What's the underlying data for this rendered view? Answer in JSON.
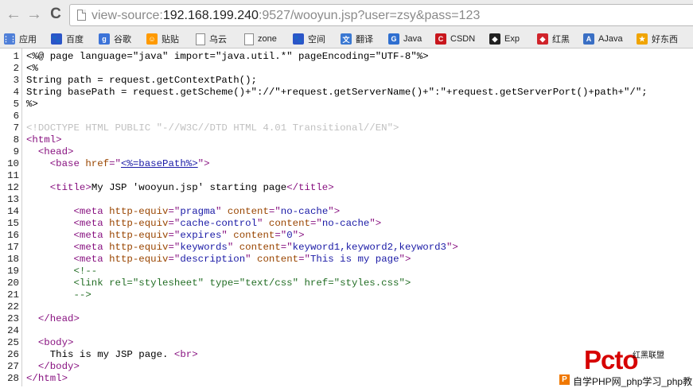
{
  "browser": {
    "back_icon": "arrow-left-icon",
    "forward_icon": "arrow-right-icon",
    "reload_icon": "reload-icon",
    "page_icon": "page-icon",
    "url_scheme": "view-source:",
    "url_host": "192.168.199.240",
    "url_rest": ":9527/wooyun.jsp?user=zsy&pass=123"
  },
  "bookmarks": [
    {
      "label": "应用",
      "icon": "apps-grid-icon",
      "color": "#4f7fd8",
      "glyph": "⋮⋮"
    },
    {
      "label": "百度",
      "icon": "baidu-icon",
      "color": "#2b55c8",
      "glyph": "🐾"
    },
    {
      "label": "谷歌",
      "icon": "google-icon",
      "color": "#3c73d8",
      "glyph": "g"
    },
    {
      "label": "贴贴",
      "icon": "tieba-icon",
      "color": "#ff9a00",
      "glyph": "☺"
    },
    {
      "label": "乌云",
      "icon": "folder-icon",
      "color": "#ffffff",
      "glyph": ""
    },
    {
      "label": "zone",
      "icon": "folder-icon",
      "color": "#ffffff",
      "glyph": ""
    },
    {
      "label": "空间",
      "icon": "baidu-space-icon",
      "color": "#2b55c8",
      "glyph": "🐾"
    },
    {
      "label": "翻译",
      "icon": "translate-icon",
      "color": "#3a78d2",
      "glyph": "文"
    },
    {
      "label": "Java",
      "icon": "java-icon",
      "color": "#2f6fd0",
      "glyph": "G"
    },
    {
      "label": "CSDN",
      "icon": "csdn-icon",
      "color": "#c8161d",
      "glyph": "C"
    },
    {
      "label": "Exp",
      "icon": "exploit-icon",
      "color": "#222222",
      "glyph": "◆"
    },
    {
      "label": "红黑",
      "icon": "shield-icon",
      "color": "#d0242b",
      "glyph": "◆"
    },
    {
      "label": "AJava",
      "icon": "ajava-icon",
      "color": "#3a6fc4",
      "glyph": "A"
    },
    {
      "label": "好东西",
      "icon": "gift-icon",
      "color": "#f0a400",
      "glyph": "★"
    }
  ],
  "source_lines": [
    [
      [
        "plain",
        "<%@ page language=\"java\" import=\"java.util.*\" pageEncoding=\"UTF-8\"%>"
      ]
    ],
    [
      [
        "plain",
        "<%"
      ]
    ],
    [
      [
        "plain",
        "String path = request.getContextPath();"
      ]
    ],
    [
      [
        "plain",
        "String basePath = request.getScheme()+\"://\"+request.getServerName()+\":\"+request.getServerPort()+path+\"/\";"
      ]
    ],
    [
      [
        "plain",
        "%>"
      ]
    ],
    [
      [
        "plain",
        ""
      ]
    ],
    [
      [
        "doctype",
        "<!DOCTYPE HTML PUBLIC \"-//W3C//DTD HTML 4.01 Transitional//EN\">"
      ]
    ],
    [
      [
        "tag",
        "<html>"
      ]
    ],
    [
      [
        "plain",
        "  "
      ],
      [
        "tag",
        "<head>"
      ]
    ],
    [
      [
        "plain",
        "    "
      ],
      [
        "tag",
        "<base "
      ],
      [
        "attr",
        "href"
      ],
      [
        "tag",
        "=\""
      ],
      [
        "link",
        "<%=basePath%>"
      ],
      [
        "tag",
        "\">"
      ]
    ],
    [
      [
        "plain",
        ""
      ]
    ],
    [
      [
        "plain",
        "    "
      ],
      [
        "tag",
        "<title>"
      ],
      [
        "plain",
        "My JSP 'wooyun.jsp' starting page"
      ],
      [
        "tag",
        "</title>"
      ]
    ],
    [
      [
        "plain",
        ""
      ]
    ],
    [
      [
        "plain",
        "        "
      ],
      [
        "tag",
        "<meta "
      ],
      [
        "attr",
        "http-equiv"
      ],
      [
        "tag",
        "=\""
      ],
      [
        "val",
        "pragma"
      ],
      [
        "tag",
        "\" "
      ],
      [
        "attr",
        "content"
      ],
      [
        "tag",
        "=\""
      ],
      [
        "val",
        "no-cache"
      ],
      [
        "tag",
        "\">"
      ]
    ],
    [
      [
        "plain",
        "        "
      ],
      [
        "tag",
        "<meta "
      ],
      [
        "attr",
        "http-equiv"
      ],
      [
        "tag",
        "=\""
      ],
      [
        "val",
        "cache-control"
      ],
      [
        "tag",
        "\" "
      ],
      [
        "attr",
        "content"
      ],
      [
        "tag",
        "=\""
      ],
      [
        "val",
        "no-cache"
      ],
      [
        "tag",
        "\">"
      ]
    ],
    [
      [
        "plain",
        "        "
      ],
      [
        "tag",
        "<meta "
      ],
      [
        "attr",
        "http-equiv"
      ],
      [
        "tag",
        "=\""
      ],
      [
        "val",
        "expires"
      ],
      [
        "tag",
        "\" "
      ],
      [
        "attr",
        "content"
      ],
      [
        "tag",
        "=\""
      ],
      [
        "val",
        "0"
      ],
      [
        "tag",
        "\">"
      ]
    ],
    [
      [
        "plain",
        "        "
      ],
      [
        "tag",
        "<meta "
      ],
      [
        "attr",
        "http-equiv"
      ],
      [
        "tag",
        "=\""
      ],
      [
        "val",
        "keywords"
      ],
      [
        "tag",
        "\" "
      ],
      [
        "attr",
        "content"
      ],
      [
        "tag",
        "=\""
      ],
      [
        "val",
        "keyword1,keyword2,keyword3"
      ],
      [
        "tag",
        "\">"
      ]
    ],
    [
      [
        "plain",
        "        "
      ],
      [
        "tag",
        "<meta "
      ],
      [
        "attr",
        "http-equiv"
      ],
      [
        "tag",
        "=\""
      ],
      [
        "val",
        "description"
      ],
      [
        "tag",
        "\" "
      ],
      [
        "attr",
        "content"
      ],
      [
        "tag",
        "=\""
      ],
      [
        "val",
        "This is my page"
      ],
      [
        "tag",
        "\">"
      ]
    ],
    [
      [
        "plain",
        "        "
      ],
      [
        "comment",
        "<!--"
      ]
    ],
    [
      [
        "plain",
        "        "
      ],
      [
        "comment",
        "<link rel=\"stylesheet\" type=\"text/css\" href=\"styles.css\">"
      ]
    ],
    [
      [
        "plain",
        "        "
      ],
      [
        "comment",
        "-->"
      ]
    ],
    [
      [
        "plain",
        ""
      ]
    ],
    [
      [
        "plain",
        "  "
      ],
      [
        "tag",
        "</head>"
      ]
    ],
    [
      [
        "plain",
        ""
      ]
    ],
    [
      [
        "plain",
        "  "
      ],
      [
        "tag",
        "<body>"
      ]
    ],
    [
      [
        "plain",
        "    This is my JSP page. "
      ],
      [
        "tag",
        "<br>"
      ]
    ],
    [
      [
        "plain",
        "  "
      ],
      [
        "tag",
        "</body>"
      ]
    ],
    [
      [
        "tag",
        "</html>"
      ]
    ]
  ],
  "watermark": {
    "logo": "Pcto",
    "brand": "红黑联盟",
    "p_icon": "P",
    "caption": "自学PHP网_php学习_php教"
  }
}
